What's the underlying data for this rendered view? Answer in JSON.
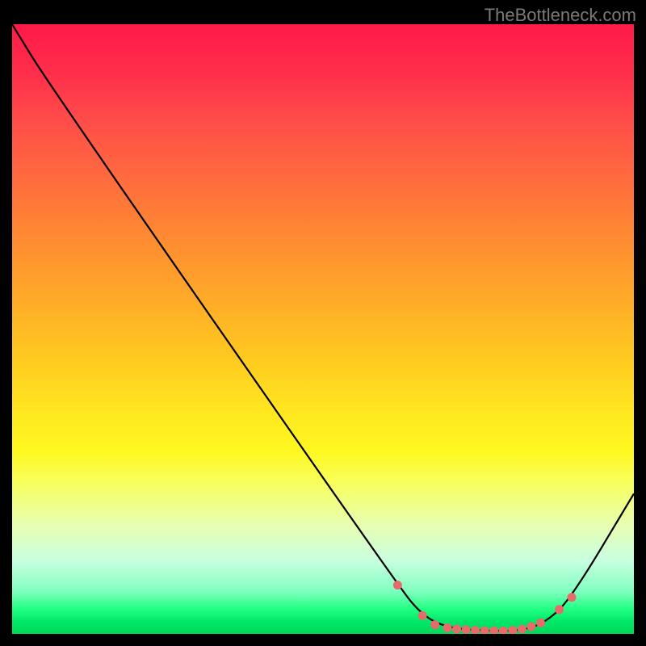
{
  "attribution": "TheBottleneck.com",
  "chart_data": {
    "type": "line",
    "title": "",
    "xlabel": "",
    "ylabel": "",
    "xlim": [
      0,
      100
    ],
    "ylim": [
      0,
      100
    ],
    "curve_points": [
      {
        "x": 0,
        "y": 100
      },
      {
        "x": 6,
        "y": 90
      },
      {
        "x": 62,
        "y": 8
      },
      {
        "x": 66,
        "y": 3
      },
      {
        "x": 70,
        "y": 1
      },
      {
        "x": 76,
        "y": 0.5
      },
      {
        "x": 82,
        "y": 0.5
      },
      {
        "x": 86,
        "y": 2
      },
      {
        "x": 90,
        "y": 6
      },
      {
        "x": 100,
        "y": 23
      }
    ],
    "marker_points": [
      {
        "x": 62,
        "y": 8
      },
      {
        "x": 66,
        "y": 3
      },
      {
        "x": 68,
        "y": 1.5
      },
      {
        "x": 70,
        "y": 1
      },
      {
        "x": 71.5,
        "y": 0.8
      },
      {
        "x": 73,
        "y": 0.7
      },
      {
        "x": 74.5,
        "y": 0.6
      },
      {
        "x": 76,
        "y": 0.5
      },
      {
        "x": 77.5,
        "y": 0.5
      },
      {
        "x": 79,
        "y": 0.5
      },
      {
        "x": 80.5,
        "y": 0.6
      },
      {
        "x": 82,
        "y": 0.8
      },
      {
        "x": 83.5,
        "y": 1.2
      },
      {
        "x": 85,
        "y": 1.8
      },
      {
        "x": 88,
        "y": 4
      },
      {
        "x": 90,
        "y": 6
      }
    ],
    "gradient_stops": [
      {
        "pos": 0,
        "color": "#ff1a4a"
      },
      {
        "pos": 25,
        "color": "#ff6a3e"
      },
      {
        "pos": 55,
        "color": "#ffca20"
      },
      {
        "pos": 75,
        "color": "#f8ff5a"
      },
      {
        "pos": 93,
        "color": "#80ffc0"
      },
      {
        "pos": 100,
        "color": "#00d858"
      }
    ],
    "marker_color": "#e86b6b",
    "line_color": "#000000"
  }
}
